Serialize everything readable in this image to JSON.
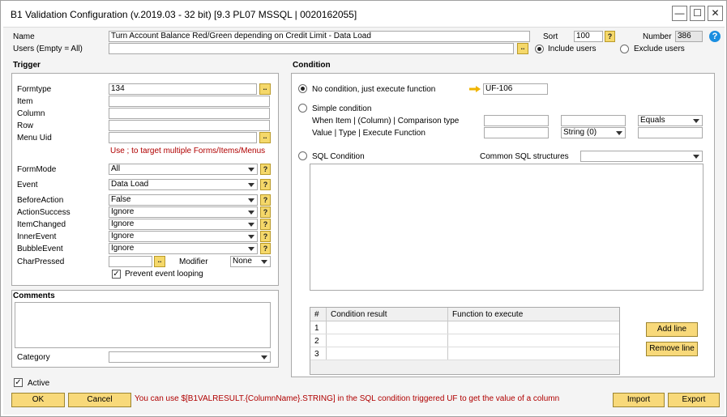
{
  "window": {
    "title": "B1 Validation Configuration (v.2019.03 - 32 bit) [9.3 PL07 MSSQL | 0020162055]"
  },
  "top": {
    "name_label": "Name",
    "name_value": "Turn Account Balance Red/Green depending on Credit Limit - Data Load",
    "users_label": "Users (Empty = All)",
    "users_value": "",
    "sort_label": "Sort",
    "sort_value": "100",
    "number_label": "Number",
    "number_value": "386",
    "include_users": "Include users",
    "exclude_users": "Exclude users"
  },
  "trigger": {
    "header": "Trigger",
    "formtype_label": "Formtype",
    "formtype_value": "134",
    "item_label": "Item",
    "item_value": "",
    "column_label": "Column",
    "column_value": "",
    "row_label": "Row",
    "row_value": "",
    "menuuid_label": "Menu Uid",
    "menuuid_value": "",
    "hint": "Use ; to target multiple Forms/Items/Menus",
    "formmode_label": "FormMode",
    "formmode_value": "All",
    "event_label": "Event",
    "event_value": "Data Load",
    "beforeaction_label": "BeforeAction",
    "beforeaction_value": "False",
    "actionsuccess_label": "ActionSuccess",
    "actionsuccess_value": "Ignore",
    "itemchanged_label": "ItemChanged",
    "itemchanged_value": "Ignore",
    "innerevent_label": "InnerEvent",
    "innerevent_value": "Ignore",
    "bubbleevent_label": "BubbleEvent",
    "bubbleevent_value": "Ignore",
    "charpressed_label": "CharPressed",
    "charpressed_value": "",
    "modifier_label": "Modifier",
    "modifier_value": "None",
    "prevent_label": "Prevent event looping"
  },
  "comments": {
    "header": "Comments",
    "value": "",
    "category_label": "Category",
    "category_value": ""
  },
  "condition": {
    "header": "Condition",
    "no_condition": "No condition, just execute function",
    "function_value": "UF-106",
    "simple_condition": "Simple condition",
    "when_label": "When Item | (Column) | Comparison type",
    "value_label": "Value | Type | Execute Function",
    "comparison_value": "Equals",
    "type_value": "String (0)",
    "sql_condition": "SQL Condition",
    "common_sql_label": "Common SQL structures",
    "common_sql_value": ""
  },
  "grid": {
    "columns": [
      "#",
      "Condition result",
      "Function to execute"
    ],
    "rows": [
      {
        "num": "1",
        "result": "",
        "func": ""
      },
      {
        "num": "2",
        "result": "",
        "func": ""
      },
      {
        "num": "3",
        "result": "",
        "func": ""
      },
      {
        "num": "",
        "result": "",
        "func": ""
      }
    ],
    "add_line": "Add line",
    "remove_line": "Remove line"
  },
  "footer": {
    "active_label": "Active",
    "ok": "OK",
    "cancel": "Cancel",
    "message": "You can use $[B1VALRESULT.{ColumnName}.STRING] in the SQL condition triggered UF to get the value of a column",
    "import": "Import",
    "export": "Export"
  },
  "colors": {
    "accent_button": "#f8d97a",
    "hint_red": "#b00000",
    "help_blue": "#1a8ee0"
  }
}
